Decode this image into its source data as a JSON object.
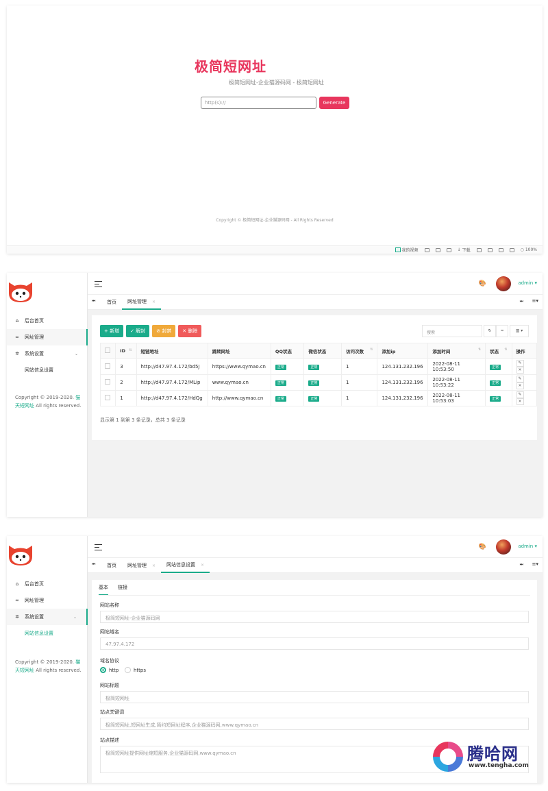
{
  "front": {
    "title": "极简短网址",
    "subtitle": "极简短网址-企业猫源码网 - 极简短网址",
    "input_placeholder": "http(s)://",
    "generate_label": "Generate",
    "copyright": "Copyright © 极简短网址-企业猫源码网 - All Rights Reserved",
    "statusbar": [
      "我的视频",
      "下载",
      "100%"
    ]
  },
  "sidebar": {
    "items": [
      {
        "label": "后台首页",
        "icon": "home-icon"
      },
      {
        "label": "网址管理",
        "icon": "link-icon"
      },
      {
        "label": "系统设置",
        "icon": "gear-icon"
      }
    ],
    "sub_items": [
      {
        "label": "网站信息设置"
      }
    ],
    "copyright_prefix": "Copyright © 2019-2020.",
    "copyright_brand": "猫天短网址",
    "copyright_suffix": "All rights reserved."
  },
  "header": {
    "user": "admin"
  },
  "tabs_list": {
    "items": [
      {
        "label": "首页"
      },
      {
        "label": "网址管理"
      }
    ]
  },
  "tabs_form": {
    "items": [
      {
        "label": "首页"
      },
      {
        "label": "网址管理"
      },
      {
        "label": "网站信息设置"
      }
    ]
  },
  "toolbar": {
    "add": "+ 新增",
    "unban": "✓ 解封",
    "ban": "⊘ 封禁",
    "delete": "✕ 删除",
    "search_placeholder": "搜索"
  },
  "table": {
    "columns": [
      "ID",
      "短链地址",
      "跳转网址",
      "QQ状态",
      "微信状态",
      "访问次数",
      "添加ip",
      "添加时间",
      "状态",
      "操作"
    ],
    "rows": [
      {
        "id": "3",
        "short": "http://d47.97.4.172/bd5J",
        "target": "https://www.qymao.cn",
        "qq": "正常",
        "wx": "正常",
        "visits": "1",
        "ip": "124.131.232.196",
        "time": "2022-08-11 10:53:50",
        "status": "正常"
      },
      {
        "id": "2",
        "short": "http://d47.97.4.172/MLip",
        "target": "www.qymao.cn",
        "qq": "正常",
        "wx": "正常",
        "visits": "1",
        "ip": "124.131.232.196",
        "time": "2022-08-11 10:53:22",
        "status": "正常"
      },
      {
        "id": "1",
        "short": "http://d47.97.4.172/HdQg",
        "target": "http://www.qymao.cn",
        "qq": "正常",
        "wx": "正常",
        "visits": "1",
        "ip": "124.131.232.196",
        "time": "2022-08-11 10:53:03",
        "status": "正常"
      }
    ],
    "footer": "显示第 1 到第 3 条记录，总共 3 条记录"
  },
  "form": {
    "tabs": [
      "基本",
      "链接"
    ],
    "site_name_label": "网站名称",
    "site_name_value": "极简短网址-企业猫源码网",
    "domain_label": "网站域名",
    "domain_value": "47.97.4.172",
    "protocol_label": "域名协议",
    "protocol_options": [
      "http",
      "https"
    ],
    "title_label": "网站标题",
    "title_value": "极简短网址",
    "keywords_label": "站点关键词",
    "keywords_value": "极简短网址,短网址生成,简约短网址程序,企业猫源码网,www.qymao.cn",
    "desc_label": "站点描述",
    "desc_value": "极简短网址提供网址缩短服务,企业猫源码网,www.qymao.cn"
  },
  "watermark": {
    "name": "腾哈网",
    "url": "www.tengha.com"
  },
  "colors": {
    "accent": "#1aab8a",
    "brand": "#e8365d"
  }
}
